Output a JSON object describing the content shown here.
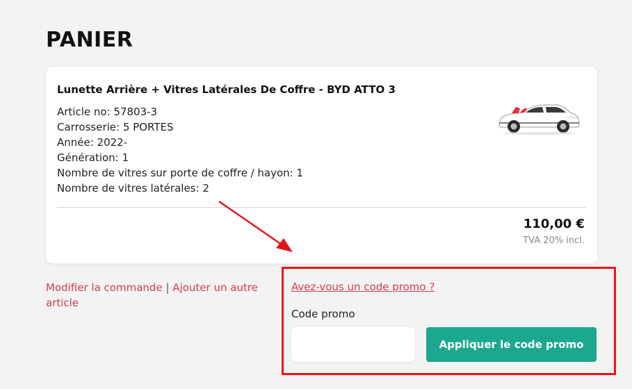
{
  "page": {
    "title": "PANIER"
  },
  "cart_item": {
    "title": "Lunette Arrière + Vitres Latérales De Coffre - BYD ATTO 3",
    "specs": [
      "Article no: 57803-3",
      "Carrosserie: 5 PORTES",
      "Année: 2022-",
      "Génération: 1",
      "Nombre de vitres sur porte de coffre / hayon: 1",
      "Nombre de vitres latérales: 2"
    ],
    "price": "110,00 €",
    "tax": "TVA 20% incl."
  },
  "actions": {
    "modify_order": "Modifier la commande",
    "separator": "|",
    "add_item": "Ajouter un autre article"
  },
  "promo": {
    "question_link": "Avez-vous un code promo ?",
    "label": "Code promo",
    "input_value": "",
    "input_placeholder": "",
    "apply_button": "Appliquer le code promo"
  },
  "colors": {
    "accent_link": "#d63d4a",
    "button": "#1ba88f",
    "annotation": "#e8141c",
    "background": "#f3f3f3"
  },
  "icons": {
    "product_image": "car-icon"
  }
}
